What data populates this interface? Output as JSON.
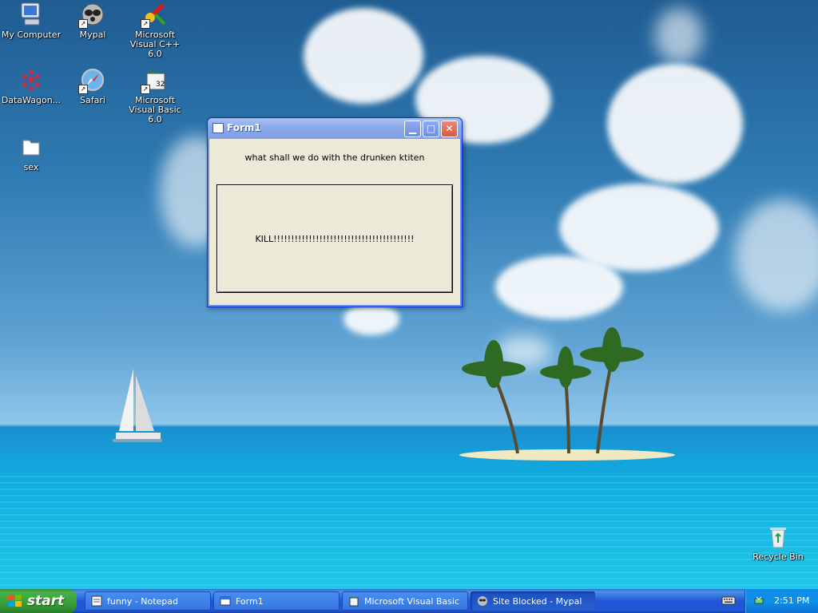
{
  "desktop": {
    "icons": [
      {
        "label": "My Computer",
        "icon": "my-computer-icon"
      },
      {
        "label": "Mypal",
        "icon": "mypal-raccoon-icon"
      },
      {
        "label": "Microsoft Visual C++ 6.0",
        "icon": "visual-cpp-icon"
      },
      {
        "label": "DataWagon...",
        "icon": "datawagon-icon"
      },
      {
        "label": "Safari",
        "icon": "safari-compass-icon"
      },
      {
        "label": "Microsoft Visual Basic 6.0",
        "icon": "visual-basic-icon"
      },
      {
        "label": "sex",
        "icon": "folder-icon"
      },
      {
        "label": "Recycle Bin",
        "icon": "recycle-bin-icon"
      }
    ]
  },
  "window": {
    "title": "Form1",
    "label": "what shall we do with the drunken ktiten",
    "button_text": "KILL!!!!!!!!!!!!!!!!!!!!!!!!!!!!!!!!!!!!!!!!",
    "minimize_symbol": "▁",
    "maximize_symbol": "□",
    "close_symbol": "✕"
  },
  "taskbar": {
    "start_label": "start",
    "tasks": [
      {
        "label": "funny - Notepad",
        "icon": "notepad-icon",
        "active": false
      },
      {
        "label": "Form1",
        "icon": "form-icon",
        "active": false
      },
      {
        "label": "Microsoft Visual Basic",
        "icon": "visual-basic-icon",
        "active": false
      },
      {
        "label": "Site Blocked - Mypal",
        "icon": "mypal-raccoon-icon",
        "active": true
      }
    ],
    "clock": "2:51 PM"
  },
  "colors": {
    "taskbar_blue": "#2157d7",
    "start_green": "#379f37",
    "window_face": "#ece9d8",
    "titlebar_inactive": "#8aa9ea"
  }
}
